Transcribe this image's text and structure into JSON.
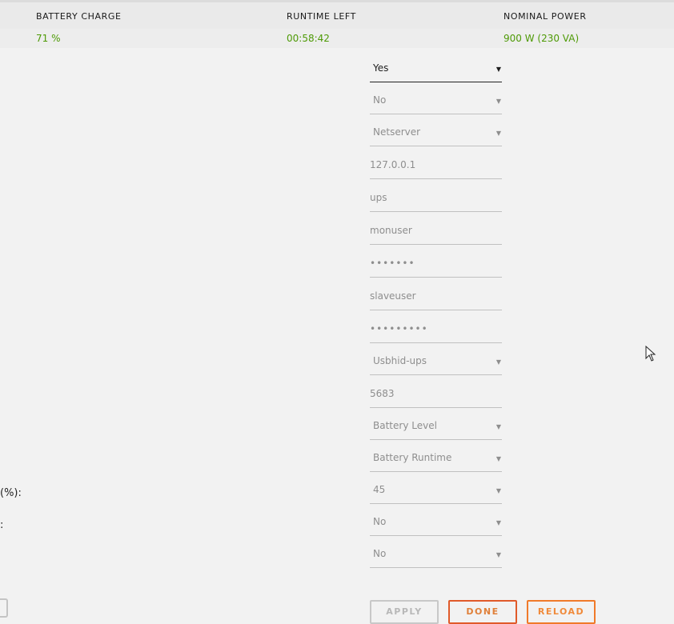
{
  "status": {
    "headers": [
      "BATTERY CHARGE",
      "RUNTIME LEFT",
      "NOMINAL POWER"
    ],
    "values": [
      "71 %",
      "00:58:42",
      "900 W (230 VA)"
    ]
  },
  "fields": [
    {
      "name": "enable-select",
      "type": "select",
      "value": "Yes",
      "active": true
    },
    {
      "name": "setting-2-select",
      "type": "select",
      "value": "No"
    },
    {
      "name": "mode-select",
      "type": "select",
      "value": "Netserver"
    },
    {
      "name": "listen-address-input",
      "type": "input",
      "value": "127.0.0.1"
    },
    {
      "name": "ups-name-input",
      "type": "input",
      "value": "ups"
    },
    {
      "name": "monitor-user-input",
      "type": "input",
      "value": "monuser"
    },
    {
      "name": "monitor-password-input",
      "type": "password",
      "value": "•••••••"
    },
    {
      "name": "slave-user-input",
      "type": "input",
      "value": "slaveuser"
    },
    {
      "name": "slave-password-input",
      "type": "password",
      "value": "•••••••••"
    },
    {
      "name": "driver-select",
      "type": "select",
      "value": "Usbhid-ups"
    },
    {
      "name": "port-input",
      "type": "input",
      "value": "5683"
    },
    {
      "name": "shutdown-condition-select",
      "type": "select",
      "value": "Battery Level"
    },
    {
      "name": "runtime-condition-select",
      "type": "select",
      "value": "Battery Runtime"
    },
    {
      "name": "battery-level-percent-select",
      "type": "select",
      "value": "45"
    },
    {
      "name": "setting-15-select",
      "type": "select",
      "value": "No"
    },
    {
      "name": "setting-16-select",
      "type": "select",
      "value": "No"
    }
  ],
  "left_labels": {
    "battery_level": "(%):",
    "setting_15": ":"
  },
  "buttons": {
    "apply": "APPLY",
    "done": "DONE",
    "reload": "RELOAD"
  }
}
